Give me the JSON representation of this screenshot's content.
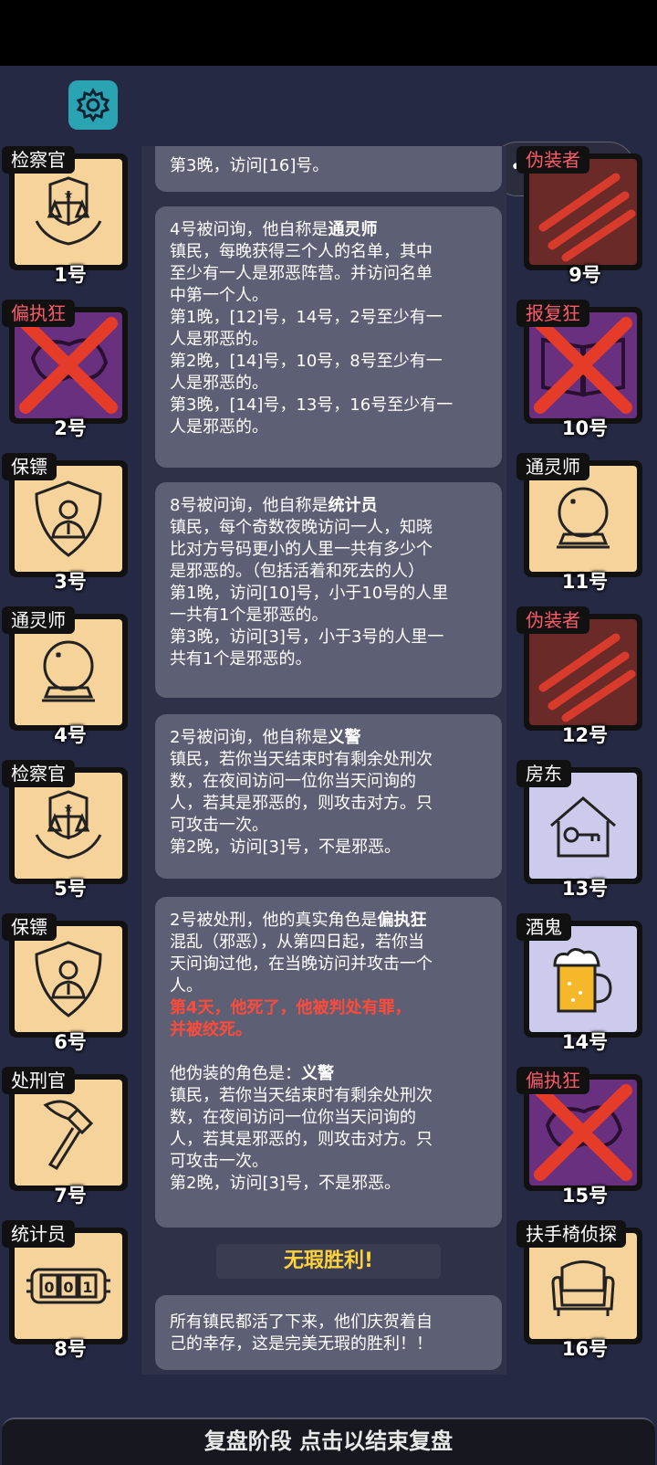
{
  "header": {
    "settings_icon": "gear-icon",
    "more_icon": "more-dots-icon",
    "close_icon": "record-circle-icon"
  },
  "players_left": [
    {
      "role": "检察官",
      "num": "1号",
      "art": "scales-shield-icon",
      "bg": "peach",
      "crossed": false
    },
    {
      "role": "偏执狂",
      "num": "2号",
      "art": "cloud-icon",
      "bg": "purple",
      "crossed": true
    },
    {
      "role": "保镖",
      "num": "3号",
      "art": "bodyguard-shield-icon",
      "bg": "peach",
      "crossed": false
    },
    {
      "role": "通灵师",
      "num": "4号",
      "art": "crystal-ball-icon",
      "bg": "peach",
      "crossed": false
    },
    {
      "role": "检察官",
      "num": "5号",
      "art": "scales-shield-icon",
      "bg": "peach",
      "crossed": false
    },
    {
      "role": "保镖",
      "num": "6号",
      "art": "bodyguard-shield-icon",
      "bg": "peach",
      "crossed": false
    },
    {
      "role": "处刑官",
      "num": "7号",
      "art": "axe-icon",
      "bg": "peach",
      "crossed": false
    },
    {
      "role": "统计员",
      "num": "8号",
      "art": "counter-icon",
      "bg": "peach",
      "crossed": false
    }
  ],
  "players_right": [
    {
      "role": "伪装者",
      "num": "9号",
      "art": "claw-mask-icon",
      "bg": "maroon",
      "crossed": false
    },
    {
      "role": "报复狂",
      "num": "10号",
      "art": "book-icon",
      "bg": "purple",
      "crossed": true
    },
    {
      "role": "通灵师",
      "num": "11号",
      "art": "crystal-ball-icon",
      "bg": "peach",
      "crossed": false
    },
    {
      "role": "伪装者",
      "num": "12号",
      "art": "claw-mask-icon",
      "bg": "maroon",
      "crossed": false
    },
    {
      "role": "房东",
      "num": "13号",
      "art": "house-key-icon",
      "bg": "lav",
      "crossed": false
    },
    {
      "role": "酒鬼",
      "num": "14号",
      "art": "beer-mug-icon",
      "bg": "lav",
      "crossed": false
    },
    {
      "role": "偏执狂",
      "num": "15号",
      "art": "cloud-icon",
      "bg": "purple",
      "crossed": true
    },
    {
      "role": "扶手椅侦探",
      "num": "16号",
      "art": "armchair-icon",
      "bg": "peach",
      "crossed": false
    }
  ],
  "messages": {
    "m0": {
      "l1": "第3晚，访问[16]号。"
    },
    "m1": {
      "title_prefix": "4号被问询，他自称是",
      "title_role": "通灵师",
      "l1": "镇民，每晚获得三个人的名单，其中",
      "l2": "至少有一人是邪恶阵营。并访问名单",
      "l3": "中第一个人。",
      "l4": "第1晚，[12]号，14号，2号至少有一",
      "l5": "人是邪恶的。",
      "l6": "第2晚，[14]号，10号，8号至少有一",
      "l7": "人是邪恶的。",
      "l8": "第3晚，[14]号，13号，16号至少有一",
      "l9": "人是邪恶的。"
    },
    "m2": {
      "title_prefix": "8号被问询，他自称是",
      "title_role": "统计员",
      "l1": "镇民，每个奇数夜晚访问一人，知晓",
      "l2": "比对方号码更小的人里一共有多少个",
      "l3": "是邪恶的。（包括活着和死去的人）",
      "l4": "第1晚，访问[10]号，小于10号的人里",
      "l5": "一共有1个是邪恶的。",
      "l6": "第3晚，访问[3]号，小于3号的人里一",
      "l7": "共有1个是邪恶的。"
    },
    "m3": {
      "title_prefix": "2号被问询，他自称是",
      "title_role": "义警",
      "l1": "镇民，若你当天结束时有剩余处刑次",
      "l2": "数，在夜间访问一位你当天问询的",
      "l3": "人，若其是邪恶的，则攻击对方。只",
      "l4": "可攻击一次。",
      "l5": "第2晚，访问[3]号，不是邪恶。"
    },
    "m4": {
      "title_prefix": "2号被处刑，他的真实角色是",
      "title_role": "偏执狂",
      "l1": "混乱（邪恶），从第四日起，若你当",
      "l2": "天问询过他，在当晚访问并攻击一个",
      "l3": "人。",
      "h1": "第4天，他死了，他被判处有罪，",
      "h2": "并被绞死。",
      "l4_prefix": "他伪装的角色是：",
      "l4_role": "义警",
      "l5": "镇民，若你当天结束时有剩余处刑次",
      "l6": "数，在夜间访问一位你当天问询的",
      "l7": "人，若其是邪恶的，则攻击对方。只",
      "l8": "可攻击一次。",
      "l9": "第2晚，访问[3]号，不是邪恶。"
    },
    "victory": "无瑕胜利!",
    "m5": {
      "l1": "所有镇民都活了下来，他们庆贺着自",
      "l2": "己的幸存，这是完美无瑕的胜利！！"
    }
  },
  "bottom_bar": "复盘阶段 点击以结束复盘",
  "colors": {
    "background": "#262943",
    "bubble": "#5d6074",
    "highlight": "#ff4a3a",
    "victory": "#ffd23a",
    "peach": "#f6d39a",
    "purple": "#6a3080"
  }
}
